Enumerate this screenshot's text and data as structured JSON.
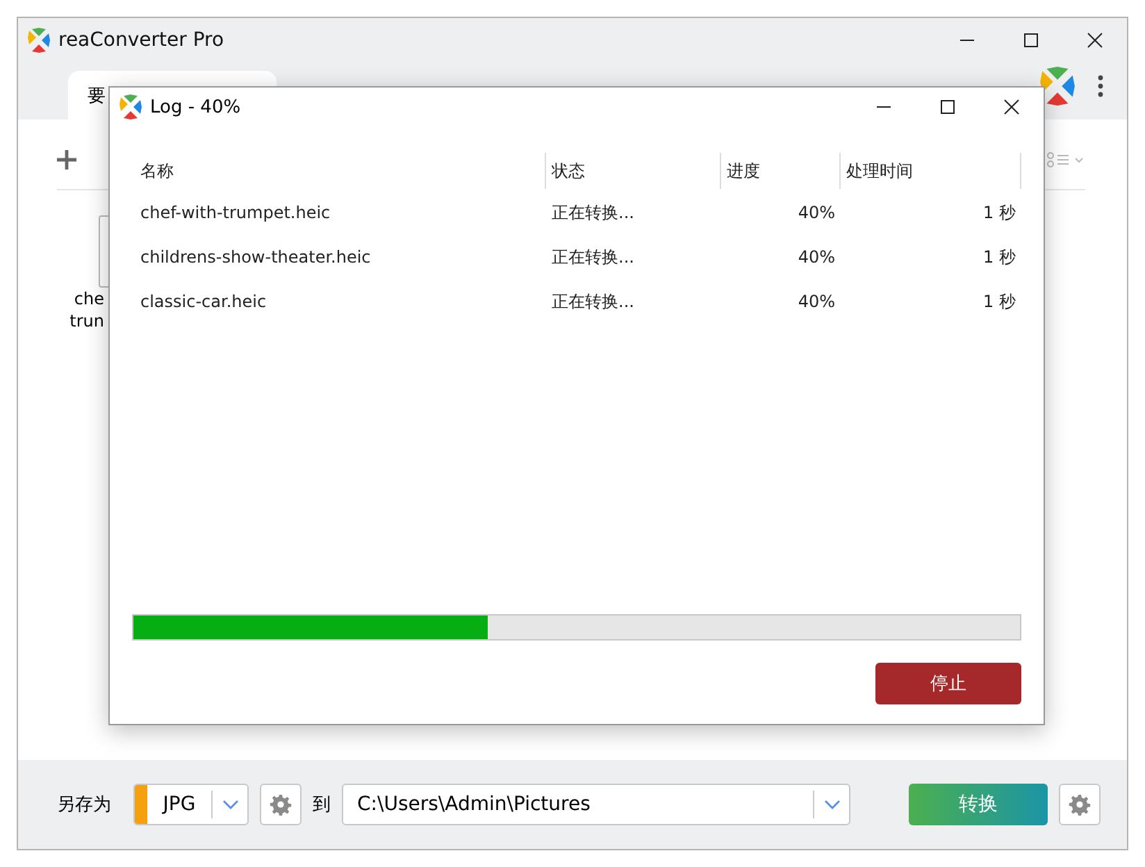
{
  "window": {
    "title": "reaConverter Pro"
  },
  "tab": {
    "label": "要",
    "selected": true
  },
  "thumbnail": {
    "caption_lines": [
      "che",
      "trun"
    ]
  },
  "dialog": {
    "title": "Log - 40%",
    "columns": [
      "名称",
      "状态",
      "进度",
      "处理时间"
    ],
    "rows": [
      {
        "name": "chef-with-trumpet.heic",
        "status": "正在转换...",
        "progress": "40%",
        "time": "1 秒"
      },
      {
        "name": "childrens-show-theater.heic",
        "status": "正在转换...",
        "progress": "40%",
        "time": "1 秒"
      },
      {
        "name": "classic-car.heic",
        "status": "正在转换...",
        "progress": "40%",
        "time": "1 秒"
      }
    ],
    "progress": {
      "level": 0.4
    },
    "stop_button": "停止"
  },
  "bottom_bar": {
    "save_as_label": "另存为",
    "format": {
      "value": "JPG",
      "color": "#f5a00f"
    },
    "to_label": "到",
    "path": "C:\\Users\\Admin\\Pictures",
    "convert_button": "转换"
  }
}
